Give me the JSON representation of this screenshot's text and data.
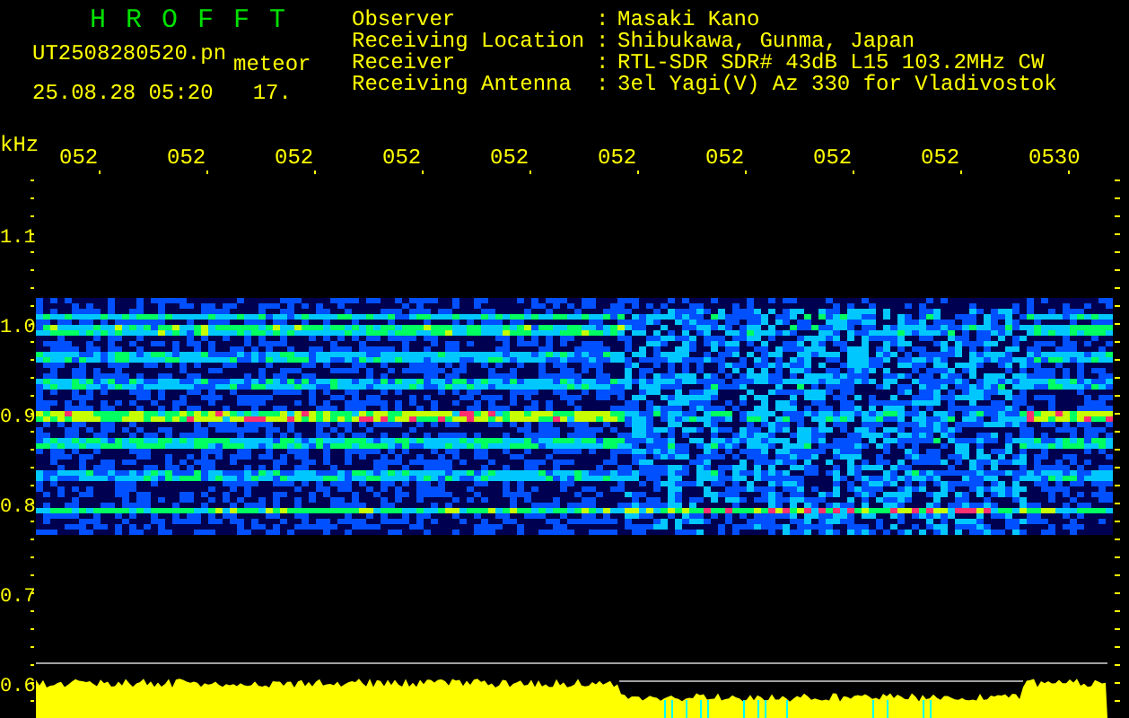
{
  "header": {
    "logo": "H R O F F T",
    "filename": "UT2508280520.pn",
    "mode": "meteor",
    "datetime": "25.08.28 05:20",
    "value": "17."
  },
  "info": [
    {
      "label": "Observer",
      "separator": ":",
      "value": "Masaki Kano"
    },
    {
      "label": "Receiving Location",
      "separator": ":",
      "value": "Shibukawa, Gunma, Japan"
    },
    {
      "label": "Receiver",
      "separator": ":",
      "value": "RTL-SDR SDR# 43dB L15 103.2MHz CW"
    },
    {
      "label": "Receiving Antenna",
      "separator": ":",
      "value": "3el Yagi(V) Az 330 for Vladivostok"
    }
  ],
  "y_axis": {
    "unit": "kHz",
    "labels": [
      "1.1",
      "1.0",
      "0.9",
      "0.8",
      "0.7",
      "0.6"
    ]
  },
  "x_axis": {
    "labels": [
      "052",
      "052",
      "052",
      "052",
      "052",
      "052",
      "052",
      "052",
      "052",
      "0530"
    ]
  }
}
